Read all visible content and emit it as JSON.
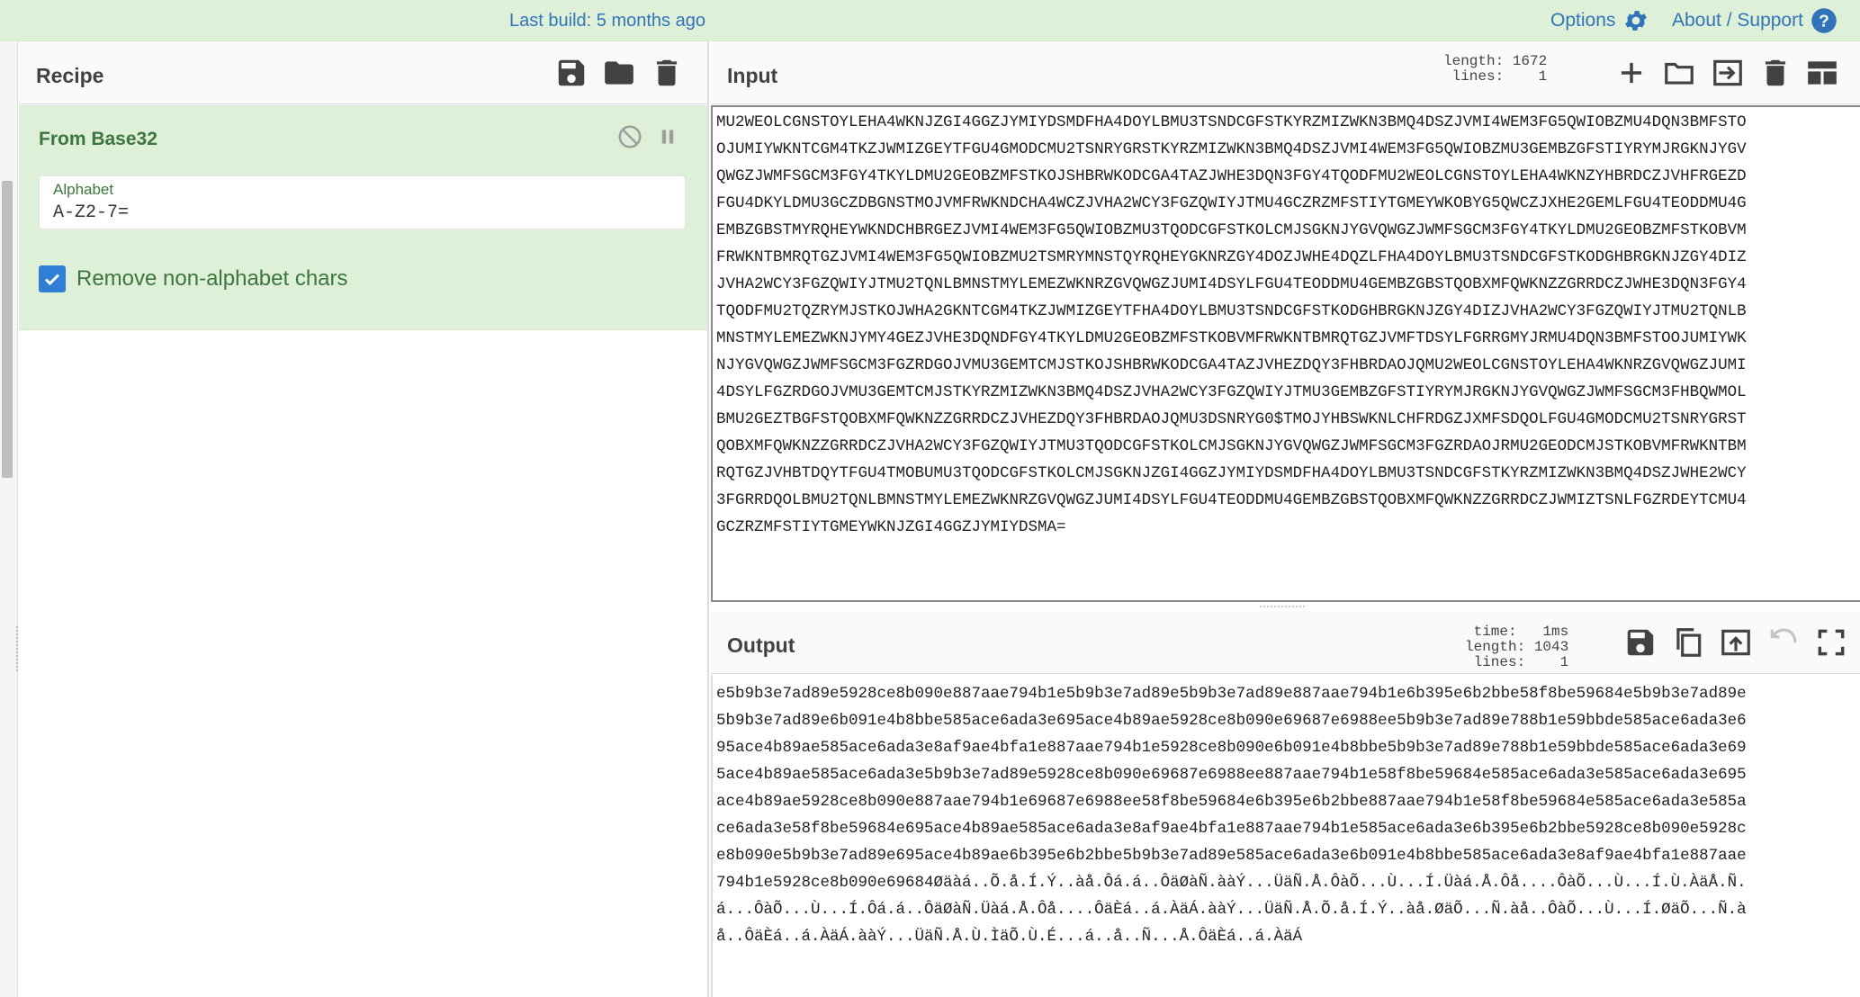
{
  "banner": {
    "build_text": "Last build: 5 months ago",
    "options_label": "Options",
    "about_label": "About / Support",
    "link_color": "#3174b9",
    "background_color": "#dff0d8"
  },
  "recipe": {
    "title": "Recipe",
    "toolbar_icons": [
      "save-icon",
      "folder-open-icon",
      "trash-icon"
    ],
    "operation": {
      "name": "From Base32",
      "controls": [
        "disable-icon",
        "pause-icon"
      ],
      "alphabet_label": "Alphabet",
      "alphabet_value": "A-Z2-7=",
      "checkbox_label": "Remove non-alphabet chars",
      "checkbox_checked": true,
      "accent_color": "#3c763d"
    }
  },
  "input": {
    "title": "Input",
    "stats_text": "length: 1672\n lines:    1",
    "toolbar_icons": [
      "plus-icon",
      "folder-open-icon",
      "import-icon",
      "trash-icon",
      "layout-icon"
    ],
    "lines": [
      "MU2WEOLCGNSTOYLEHA4WKNJZGI4GGZJYMIYDSMDFHA4DOYLBMU3TSNDCGFSTKYRZMIZWKN3BMQ4DSZJVMI4WEM3FG5QWIOBZMU4DQN3BMFSTO",
      "OJUMIYWKNTCGM4TKZJWMIZGEYTFGU4GMODCMU2TSNRYGRSTKYRZMIZWKN3BMQ4DSZJVMI4WEM3FG5QWIOBZMU3GEMBZGFSTIYRYMJRGKNJYGV",
      "QWGZJWMFSGCM3FGY4TKYLDMU2GEOBZMFSTKOJSHBRWKODCGA4TAZJWHE3DQN3FGY4TQODFMU2WEOLCGNSTOYLEHA4WKNZYHBRDCZJVHFRGEZD",
      "FGU4DKYLDMU3GCZDBGNSTMOJVMFRWKNDCHA4WCZJVHA2WCY3FGZQWIYJTMU4GCZRZMFSTIYTGMEYWKOBYG5QWCZJXHE2GEMLFGU4TEODDMU4G",
      "EMBZGBSTMYRQHEYWKNDCHBRGEZJVMI4WEM3FG5QWIOBZMU3TQODCGFSTKOLCMJSGKNJYGVQWGZJWMFSGCM3FGY4TKYLDMU2GEOBZMFSTKOBVM",
      "FRWKNTBMRQTGZJVMI4WEM3FG5QWIOBZMU2TSMRYMNSTQYRQHEYGKNRZGY4DOZJWHE4DQZLFHA4DOYLBMU3TSNDCGFSTKODGHBRGKNJZGY4DIZ",
      "JVHA2WCY3FGZQWIYJTMU2TQNLBMNSTMYLEMEZWKNRZGVQWGZJUMI4DSYLFGU4TEODDMU4GEMBZGBSTQOBXMFQWKNZZGRRDCZJWHE3DQN3FGY4",
      "TQODFMU2TQZRYMJSTKOJWHA2GKNTCGM4TKZJWMIZGEYTFHA4DOYLBMU3TSNDCGFSTKODGHBRGKNJZGY4DIZJVHA2WCY3FGZQWIYJTMU2TQNLB",
      "MNSTMYLEMEZWKNJYMY4GEZJVHE3DQNDFGY4TKYLDMU2GEOBZMFSTKOBVMFRWKNTBMRQTGZJVMFTDSYLFGRRGMYJRMU4DQN3BMFSTOOJUMIYWK",
      "NJYGVQWGZJWMFSGCM3FGZRDGOJVMU3GEMTCMJSTKOJSHBRWKODCGA4TAZJVHEZDQY3FHBRDAOJQMU2WEOLCGNSTOYLEHA4WKNRZGVQWGZJUMI",
      "4DSYLFGZRDGOJVMU3GEMTCMJSTKYRZMIZWKN3BMQ4DSZJVHA2WCY3FGZQWIYJTMU3GEMBZGFSTIYRYMJRGKNJYGVQWGZJWMFSGCM3FHBQWMOL",
      "BMU2GEZTBGFSTQOBXMFQWKNZZGRRDCZJVHEZDQY3FHBRDAOJQMU3DSNRYG0$TMOJYHBSWKNLCHFRDGZJXMFSDQOLFGU4GMODCMU2TSNRYGRST",
      "QOBXMFQWKNZZGRRDCZJVHA2WCY3FGZQWIYJTMU3TQODCGFSTKOLCMJSGKNJYGVQWGZJWMFSGCM3FGZRDAOJRMU2GEODCMJSTKOBVMFRWKNTBM",
      "RQTGZJVHBTDQYTFGU4TMOBUMU3TQODCGFSTKOLCMJSGKNJZGI4GGZJYMIYDSMDFHA4DOYLBMU3TSNDCGFSTKYRZMIZWKN3BMQ4DSZJWHE2WCY",
      "3FGRRDQOLBMU2TQNLBMNSTMYLEMEZWKNRZGVQWGZJUMI4DSYLFGU4TEODDMU4GEMBZGBSTQOBXMFQWKNZZGRRDCZJWMIZTSNLFGZRDEYTCMU4",
      "GCZRZMFSTIYTGMEYWKNJZGI4GGZJYMIYDSMA="
    ]
  },
  "output": {
    "title": "Output",
    "stats_text": "time:   1ms\nlength: 1043\n lines:    1",
    "toolbar_icons": [
      "save-icon",
      "copy-icon",
      "replace-input-icon",
      "undo-icon",
      "maximise-icon"
    ],
    "lines": [
      "e5b9b3e7ad89e5928ce8b090e887aae794b1e5b9b3e7ad89e5b9b3e7ad89e887aae794b1e6b395e6b2bbe58f8be59684e5b9b3e7ad89e",
      "5b9b3e7ad89e6b091e4b8bbe585ace6ada3e695ace4b89ae5928ce8b090e69687e6988ee5b9b3e7ad89e788b1e59bbde585ace6ada3e6",
      "95ace4b89ae585ace6ada3e8af9ae4bfa1e887aae794b1e5928ce8b090e6b091e4b8bbe5b9b3e7ad89e788b1e59bbde585ace6ada3e69",
      "5ace4b89ae585ace6ada3e5b9b3e7ad89e5928ce8b090e69687e6988ee887aae794b1e58f8be59684e585ace6ada3e585ace6ada3e695",
      "ace4b89ae5928ce8b090e887aae794b1e69687e6988ee58f8be59684e6b395e6b2bbe887aae794b1e58f8be59684e585ace6ada3e585a",
      "ce6ada3e58f8be59684e695ace4b89ae585ace6ada3e8af9ae4bfa1e887aae794b1e585ace6ada3e6b395e6b2bbe5928ce8b090e5928c",
      "e8b090e5b9b3e7ad89e695ace4b89ae6b395e6b2bbe5b9b3e7ad89e585ace6ada3e6b091e4b8bbe585ace6ada3e8af9ae4bfa1e887aae",
      "794b1e5928ce8b090e69684Øäàá..Õ.å.Í.Ý..àå.Ôá.á..ÔäØàÑ.ààÝ...ÜäÑ.Å.ÔàÕ...Ù...Í.Üàá.Å.Ôå....ÔàÕ...Ù...Í.Ù.ÀäÅ.Ñ.",
      "á...ÔàÕ...Ù...Í.Ôá.á..ÔäØàÑ.Üàá.Å.Ôå....ÔäÈá..á.ÀäÁ.ààÝ...ÜäÑ.Å.Õ.å.Í.Ý..àå.ØäÕ...Ñ.àå..ÔàÕ...Ù...Í.ØäÕ...Ñ.à",
      "å..ÔäÈá..á.ÀäÁ.ààÝ...ÜäÑ.Å.Ù.ÌäÕ.Ù.É...á..å..Ñ...Å.ÔäÈá..á.ÀäÁ"
    ]
  }
}
